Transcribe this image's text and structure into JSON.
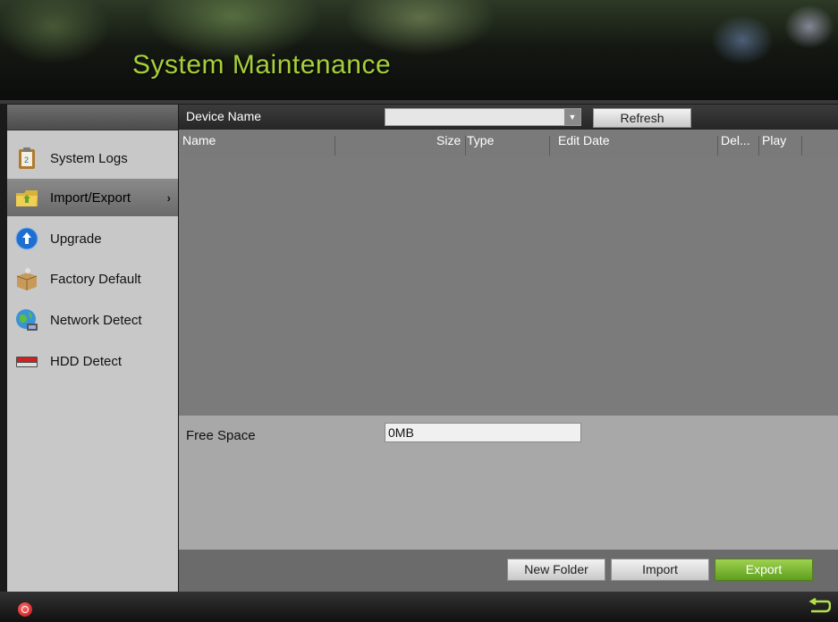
{
  "window": {
    "title": "System Maintenance"
  },
  "sidebar": {
    "items": [
      {
        "label": "System Logs",
        "icon": "clipboard-icon",
        "active": false
      },
      {
        "label": "Import/Export",
        "icon": "folder-icon",
        "active": true,
        "arrow": "›"
      },
      {
        "label": "Upgrade",
        "icon": "upgrade-arrow-icon",
        "active": false
      },
      {
        "label": "Factory Default",
        "icon": "package-icon",
        "active": false
      },
      {
        "label": "Network Detect",
        "icon": "network-globe-icon",
        "active": false
      },
      {
        "label": "HDD Detect",
        "icon": "hard-drive-icon",
        "active": false
      }
    ]
  },
  "toolbar": {
    "device_label": "Device Name",
    "device_value": "",
    "refresh_label": "Refresh"
  },
  "table": {
    "columns": [
      "Name",
      "Size",
      "Type",
      "Edit Date",
      "Del...",
      "Play"
    ],
    "rows": []
  },
  "storage": {
    "free_label": "Free Space",
    "free_value": "0MB"
  },
  "actions": {
    "new_folder": "New Folder",
    "import": "Import",
    "export": "Export"
  },
  "colors": {
    "title": "#a7cf3a",
    "export_button": "#7bb935",
    "sidebar_bg": "#c8c8c8",
    "panel_bg": "#7b7b7b"
  },
  "statusbar": {
    "left_icon": "power-icon",
    "right_icon": "back-arrow-icon"
  }
}
